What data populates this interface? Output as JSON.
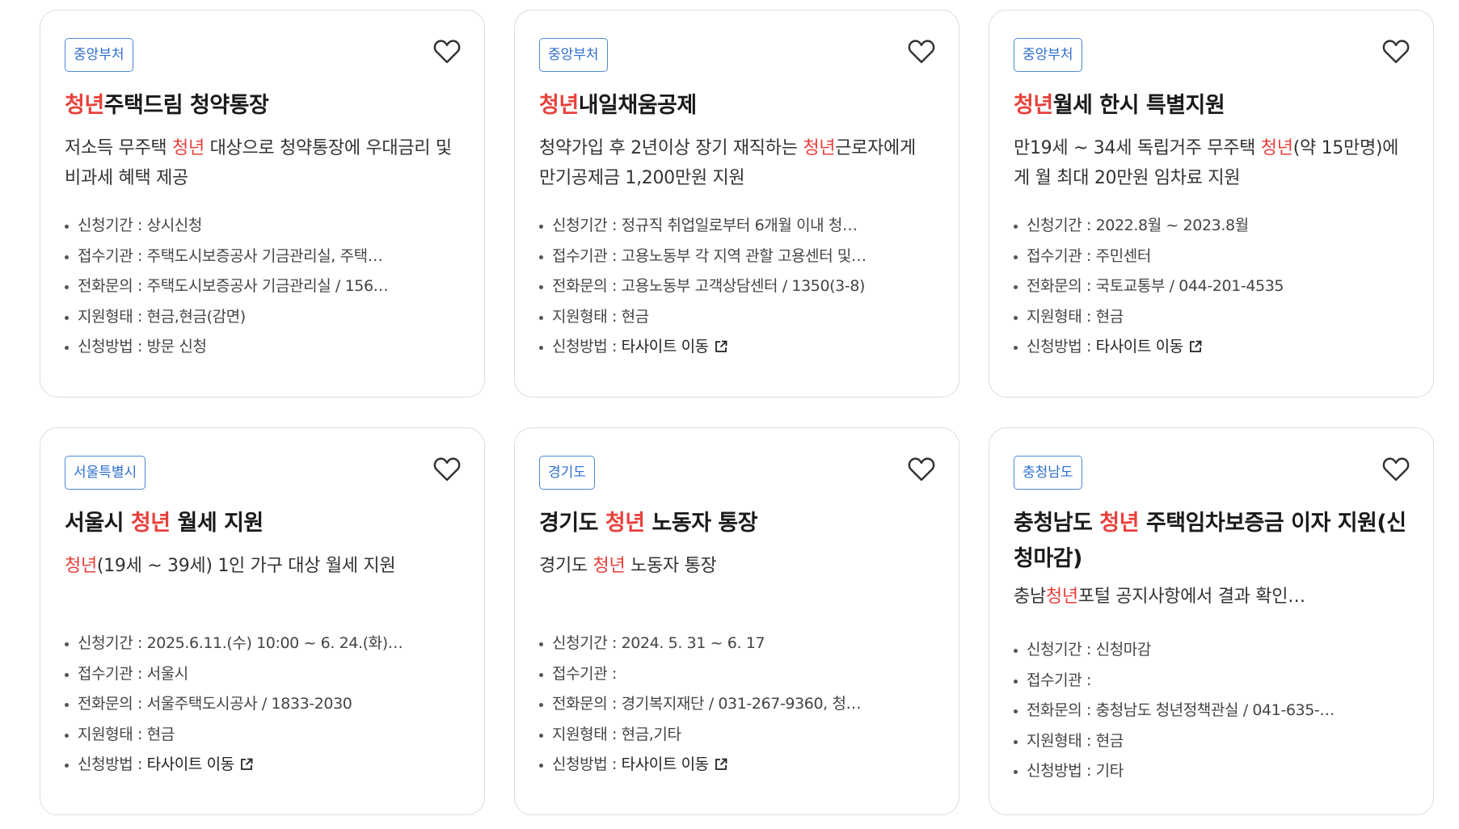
{
  "cards": [
    {
      "badge": "중앙부처",
      "title_hl": "청년",
      "title_rest": "주택드림 청약통장",
      "desc_pre": "저소득 무주택 ",
      "desc_hl": "청년",
      "desc_post": " 대상으로 청약통장에 우대금리 및 비과세 혜택 제공",
      "info": [
        {
          "label": "신청기간",
          "value": "상시신청"
        },
        {
          "label": "접수기관",
          "value": "주택도시보증공사 기금관리실, 주택…"
        },
        {
          "label": "전화문의",
          "value": "주택도시보증공사 기금관리실 / 156…"
        },
        {
          "label": "지원형태",
          "value": "현금,현금(감면)"
        },
        {
          "label": "신청방법",
          "value": "방문 신청"
        }
      ]
    },
    {
      "badge": "중앙부처",
      "title_hl": "청년",
      "title_rest": "내일채움공제",
      "desc_pre": "청약가입 후 2년이상 장기 재직하는 ",
      "desc_hl": "청년",
      "desc_post": "근로자에게 만기공제금 1,200만원 지원",
      "info": [
        {
          "label": "신청기간",
          "value": "정규직 취업일로부터 6개월 이내 청…"
        },
        {
          "label": "접수기관",
          "value": "고용노동부 각 지역 관할 고용센터 및…"
        },
        {
          "label": "전화문의",
          "value": "고용노동부 고객상담센터 / 1350(3-8)"
        },
        {
          "label": "지원형태",
          "value": "현금"
        },
        {
          "label": "신청방법",
          "value": "타사이트 이동",
          "link": true
        }
      ]
    },
    {
      "badge": "중앙부처",
      "title_hl": "청년",
      "title_rest": "월세 한시 특별지원",
      "desc_pre": "만19세 ~ 34세 독립거주 무주택 ",
      "desc_hl": "청년",
      "desc_post": "(약 15만명)에게 월 최대 20만원 임차료 지원",
      "info": [
        {
          "label": "신청기간",
          "value": "2022.8월 ~ 2023.8월"
        },
        {
          "label": "접수기관",
          "value": "주민센터"
        },
        {
          "label": "전화문의",
          "value": "국토교통부 / 044-201-4535"
        },
        {
          "label": "지원형태",
          "value": "현금"
        },
        {
          "label": "신청방법",
          "value": "타사이트 이동",
          "link": true
        }
      ]
    },
    {
      "badge": "서울특별시",
      "title_pre": "서울시 ",
      "title_hl": "청년",
      "title_rest": " 월세 지원",
      "desc_pre": "",
      "desc_hl": "청년",
      "desc_post": "(19세 ~ 39세) 1인 가구 대상 월세 지원",
      "info": [
        {
          "label": "신청기간",
          "value": "2025.6.11.(수) 10:00 ~ 6. 24.(화)…"
        },
        {
          "label": "접수기관",
          "value": "서울시"
        },
        {
          "label": "전화문의",
          "value": "서울주택도시공사 / 1833-2030"
        },
        {
          "label": "지원형태",
          "value": "현금"
        },
        {
          "label": "신청방법",
          "value": "타사이트 이동",
          "link": true
        }
      ]
    },
    {
      "badge": "경기도",
      "title_pre": "경기도 ",
      "title_hl": "청년",
      "title_rest": " 노동자 통장",
      "desc_pre": "경기도 ",
      "desc_hl": "청년",
      "desc_post": " 노동자 통장",
      "info": [
        {
          "label": "신청기간",
          "value": "2024. 5. 31 ~ 6. 17"
        },
        {
          "label": "접수기관",
          "value": ""
        },
        {
          "label": "전화문의",
          "value": "경기복지재단 / 031-267-9360, 청…"
        },
        {
          "label": "지원형태",
          "value": "현금,기타"
        },
        {
          "label": "신청방법",
          "value": "타사이트 이동",
          "link": true
        }
      ]
    },
    {
      "badge": "충청남도",
      "title_pre": "충청남도 ",
      "title_hl": "청년",
      "title_rest": " 주택임차보증금 이자 지원(신청마감)",
      "desc_pre": "충남",
      "desc_hl": "청년",
      "desc_post": "포털 공지사항에서 결과 확인…",
      "info": [
        {
          "label": "신청기간",
          "value": "신청마감"
        },
        {
          "label": "접수기관",
          "value": ""
        },
        {
          "label": "전화문의",
          "value": "충청남도 청년정책관실 / 041-635-…"
        },
        {
          "label": "지원형태",
          "value": "현금"
        },
        {
          "label": "신청방법",
          "value": "기타"
        }
      ]
    }
  ],
  "icons": {
    "favorite": "heart-outline-icon",
    "external": "external-link-icon"
  }
}
